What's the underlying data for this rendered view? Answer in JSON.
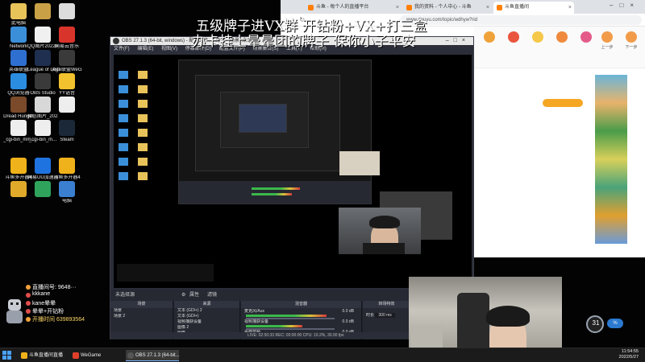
{
  "overlay": {
    "line1": "五级牌子进VX群 开钻粉+VX+打三盒",
    "line2": "办卡挂上晕晕团的牌子 保你小子平安"
  },
  "desktop_icons": [
    {
      "label": "此电脑",
      "icon": "computer-icon",
      "color": "#e8c35a"
    },
    {
      "label": "",
      "icon": "user-folder-icon",
      "color": "#c9a046"
    },
    {
      "label": "",
      "icon": "recycle-bin-icon",
      "color": "#dcdcdc"
    },
    {
      "label": "Network",
      "icon": "network-icon",
      "color": "#3b8fd9"
    },
    {
      "label": "QQ图片20220...",
      "icon": "image-file-icon",
      "color": "#f0f0f0"
    },
    {
      "label": "网易云音乐",
      "icon": "netease-music-icon",
      "color": "#d9342b"
    },
    {
      "label": "英雄联盟",
      "icon": "lol-icon",
      "color": "#2f6fcf"
    },
    {
      "label": "League of Legends",
      "icon": "league-icon",
      "color": "#1e2f4f"
    },
    {
      "label": "英雄联盟WeGame版",
      "icon": "wegame-lol-icon",
      "color": "#3a3a3a"
    },
    {
      "label": "QQ浏览器",
      "icon": "qq-browser-icon",
      "color": "#2b8de0"
    },
    {
      "label": "OBS Studio",
      "icon": "obs-icon",
      "color": "#3a3a3a"
    },
    {
      "label": "YY语音",
      "icon": "yy-icon",
      "color": "#f2c12e"
    },
    {
      "label": "Dread Hunger",
      "icon": "dread-hunger-icon",
      "color": "#7a4a2a"
    },
    {
      "label": "微信图片_2022051...",
      "icon": "image-file-icon",
      "color": "#d8d8d8"
    },
    {
      "label": "",
      "icon": "blank-file-icon",
      "color": "#eeeeee"
    },
    {
      "label": "_cgi-bin_mm...",
      "icon": "file-icon",
      "color": "#eeeeee"
    },
    {
      "label": "_cgi-bin_m...",
      "icon": "file-icon",
      "color": "#eeeeee"
    },
    {
      "label": "Steam",
      "icon": "steam-icon",
      "color": "#1b2838"
    },
    {
      "label": "斗鱼多开器4",
      "icon": "douyu-icon",
      "color": "#f0b21a"
    },
    {
      "label": "网易UU加速器",
      "icon": "uu-accelerator-icon",
      "color": "#1f73e0"
    },
    {
      "label": "斗鱼多开器4",
      "icon": "douyu-icon",
      "color": "#f0b21a"
    },
    {
      "label": "",
      "icon": "app-icon",
      "color": "#e0a92a"
    },
    {
      "label": "",
      "icon": "app-icon",
      "color": "#2fa35c"
    },
    {
      "label": "电脑",
      "icon": "app-icon",
      "color": "#3a7fd0"
    }
  ],
  "browser": {
    "tabs": [
      {
        "label": "斗鱼 - 每个人的直播平台"
      },
      {
        "label": "我的资料 - 个人中心 - 斗鱼"
      },
      {
        "label": "斗鱼直播间"
      }
    ],
    "url": "www.douyu.com/topic/wdhyw?rid",
    "nav_items": [
      "",
      "",
      "",
      "",
      "",
      "上一步",
      "下一步"
    ]
  },
  "obs": {
    "title": "OBS 27.1.3 (64-bit, windows) - 配置文件: 未命名 - 场景: 未命名",
    "menu": [
      "文件(F)",
      "编辑(E)",
      "视图(V)",
      "停靠部件(D)",
      "配置文件(P)",
      "场景集合(S)",
      "工具(T)",
      "帮助(H)"
    ],
    "scene_bar_label": "未选择源",
    "scene_bar_buttons": [
      "属性",
      "滤镜"
    ],
    "docks": {
      "scenes": {
        "title": "场景",
        "items": [
          "场景",
          "场景 2"
        ]
      },
      "sources": {
        "title": "来源",
        "items": [
          "文本 (GDI+) 2",
          "文本 (GDI+)",
          "视频捕获设备",
          "图像 2",
          "图像",
          "图像 3"
        ]
      },
      "mixer": {
        "title": "混音器",
        "channels": [
          {
            "name": "麦克风/Aux",
            "db": "0.0 dB"
          },
          {
            "name": "视频捕获设备",
            "db": "0.0 dB"
          },
          {
            "name": "桌面音频",
            "db": "0.0 dB"
          }
        ]
      },
      "transitions": {
        "title": "转场特效",
        "duration_label": "时长",
        "duration": "300 ms"
      },
      "controls": {
        "title": "控件"
      }
    },
    "status": "LIVE: 02:50:33   REC: 00:00:00   CPU: 10.2%, 30.00 fps"
  },
  "stream_info": {
    "line1": "直播间号: 9648···",
    "line2": "kkkane",
    "line3": "kane晕晕",
    "line4": "晕晕+开钻粉",
    "line5": "开播时间 639893564"
  },
  "taskbar": {
    "items": [
      {
        "label": "斗鱼直播间直播",
        "color": "#f0b21a",
        "active": false
      },
      {
        "label": "WeGame",
        "color": "#e0402a",
        "active": false
      },
      {
        "label": "OBS 27.1.3 (64-bit...",
        "color": "#333333",
        "active": true
      }
    ],
    "time": "11:54:55",
    "date": "2022/5/27"
  },
  "cpu_widget": {
    "value": "31",
    "unit": "%"
  }
}
